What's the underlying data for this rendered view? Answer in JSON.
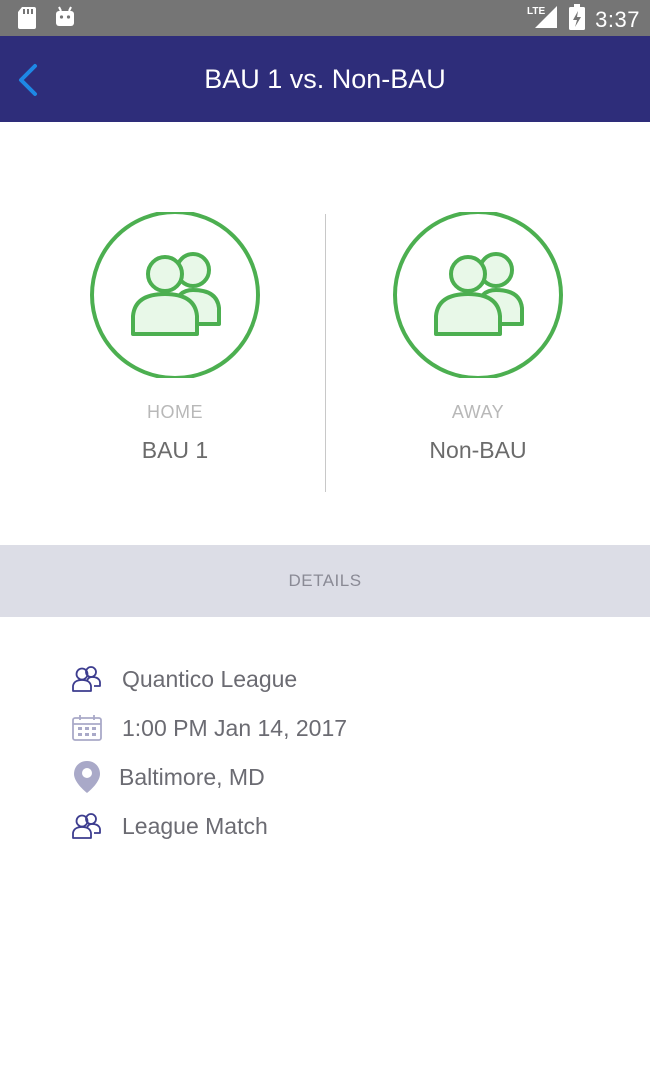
{
  "status_bar": {
    "time": "3:37",
    "network": "LTE"
  },
  "app_bar": {
    "title": "BAU 1 vs. Non-BAU",
    "back_icon": "chevron-left-icon"
  },
  "teams": {
    "home": {
      "role": "HOME",
      "name": "BAU 1",
      "icon": "team-icon"
    },
    "away": {
      "role": "AWAY",
      "name": "Non-BAU",
      "icon": "team-icon"
    }
  },
  "details": {
    "header": "DETAILS",
    "league": {
      "icon": "group-icon",
      "text": "Quantico League"
    },
    "datetime": {
      "icon": "calendar-icon",
      "text": "1:00 PM Jan 14, 2017"
    },
    "location": {
      "icon": "location-pin-icon",
      "text": "Baltimore, MD"
    },
    "match_type": {
      "icon": "group-icon",
      "text": "League Match"
    }
  },
  "colors": {
    "app_bar": "#2e2d7a",
    "accent_blue": "#1e88e5",
    "team_green": "#4caf50",
    "team_fill": "#e8f8e8",
    "details_band": "#dcdde6",
    "icon_purple": "#3d3d8f"
  }
}
